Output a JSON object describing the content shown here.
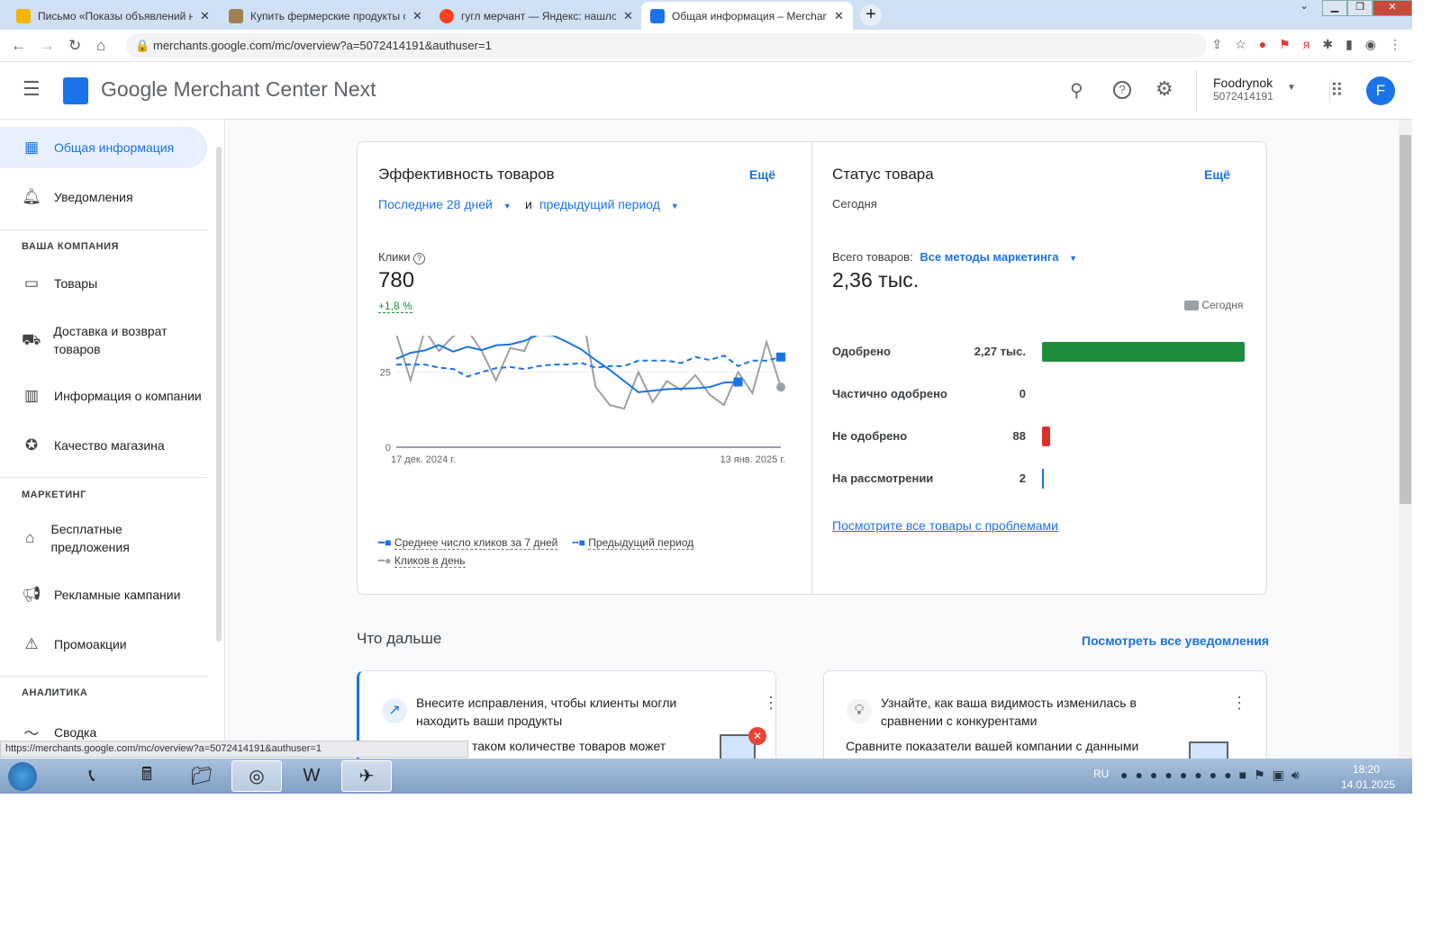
{
  "browser": {
    "tabs": [
      {
        "title": "Письмо «Показы объявлений на",
        "color": "#f4b400"
      },
      {
        "title": "Купить фермерские продукты с",
        "color": "#a08050"
      },
      {
        "title": "гугл мерчант — Яндекс: нашлось",
        "color": "#fc3f1d"
      },
      {
        "title": "Общая информация – Merchant",
        "color": "#1a73e8"
      }
    ],
    "new_tab": "+",
    "url": "merchants.google.com/mc/overview?a=5072414191&authuser=1",
    "status_url": "https://merchants.google.com/mc/overview?a=5072414191&authuser=1"
  },
  "header": {
    "title": "Google Merchant Center Next",
    "account_name": "Foodrynok",
    "account_id": "5072414191",
    "avatar": "F"
  },
  "sidebar": {
    "items": [
      {
        "label": "Общая информация",
        "icon": "dashboard-icon"
      },
      {
        "label": "Уведомления",
        "icon": "bell-icon"
      },
      {
        "label": "Товары",
        "icon": "box-icon"
      },
      {
        "label": "Доставка и возврат товаров",
        "icon": "truck-icon"
      },
      {
        "label": "Информация о компании",
        "icon": "building-icon"
      },
      {
        "label": "Качество магазина",
        "icon": "badge-icon"
      },
      {
        "label": "Бесплатные предложения",
        "icon": "tag-icon"
      },
      {
        "label": "Рекламные кампании",
        "icon": "megaphone-icon"
      },
      {
        "label": "Промоакции",
        "icon": "promo-icon"
      },
      {
        "label": "Сводка",
        "icon": "trend-icon"
      }
    ],
    "sections": [
      "ВАША КОМПАНИЯ",
      "МАРКЕТИНГ",
      "АНАЛИТИКА"
    ]
  },
  "performance": {
    "title": "Эффективность товаров",
    "more": "Ещё",
    "period": "Последние 28 дней",
    "and": "и",
    "compare": "предыдущий период",
    "metric_label": "Клики",
    "metric_value": "780",
    "metric_change": "+1,8 %"
  },
  "chart_data": {
    "type": "line",
    "ylim": [
      0,
      50
    ],
    "yticks": [
      "0",
      "25",
      "50"
    ],
    "xlabels": [
      "17 дек. 2024 г.",
      "13 янв. 2025 г."
    ],
    "series": [
      {
        "name": "Среднее число кликов за 7 дней",
        "color": "#1a73e8",
        "style": "solid",
        "values": [
          29.4,
          31.4,
          32.2,
          34,
          31.8,
          33.4,
          32.3,
          33.9,
          34.2,
          35.4,
          37.5,
          37.2,
          35,
          32.5,
          29,
          25.7,
          22,
          18.3,
          18.8,
          19.3,
          19.5,
          19.6,
          20,
          21.5,
          21.7
        ]
      },
      {
        "name": "Предыдущий период",
        "color": "#1a73e8",
        "style": "dashed",
        "values": [
          27.5,
          27.5,
          27.5,
          26.5,
          26,
          23.5,
          25,
          26.3,
          26.7,
          26,
          27,
          27.5,
          27.5,
          28,
          26.5,
          27,
          27,
          28.8,
          28.8,
          28.8,
          28,
          30,
          29,
          30.5,
          27,
          28.8,
          28.8,
          30
        ]
      },
      {
        "name": "Кликов в день",
        "color": "#9aa0a6",
        "style": "solid",
        "values": [
          37.8,
          22.2,
          39,
          32,
          37,
          39,
          32,
          22.2,
          33,
          32,
          43,
          39,
          46,
          46,
          20,
          14,
          12.8,
          25,
          15,
          22,
          19,
          24,
          17.5,
          14,
          25,
          18,
          35,
          20
        ]
      }
    ]
  },
  "status": {
    "title": "Статус товара",
    "more": "Ещё",
    "date": "Сегодня",
    "total_label": "Всего товаров:",
    "method": "Все методы маркетинга",
    "total": "2,36 тыс.",
    "legend": "Сегодня",
    "rows": [
      {
        "label": "Одобрено",
        "value": "2,27 тыс.",
        "count": 2270,
        "color": "#1e8e3e"
      },
      {
        "label": "Частично одобрено",
        "value": "0",
        "count": 0,
        "color": "#1e8e3e"
      },
      {
        "label": "Не одобрено",
        "value": "88",
        "count": 88,
        "color": "#d93025"
      },
      {
        "label": "На рассмотрении",
        "value": "2",
        "count": 2,
        "color": "#1a73e8"
      }
    ],
    "link": "Посмотрите все товары с проблемами"
  },
  "next": {
    "title": "Что дальше",
    "all": "Посмотреть все уведомления",
    "cards": [
      {
        "title": "Внесите исправления, чтобы клиенты могли находить ваши продукты",
        "text": "таком количестве товаров может"
      },
      {
        "title": "Узнайте, как ваша видимость изменилась в сравнении с конкурентами",
        "text": "Сравните показатели вашей компании с данными"
      }
    ]
  },
  "taskbar": {
    "lang": "RU",
    "time": "18:20",
    "date": "14.01.2025"
  }
}
